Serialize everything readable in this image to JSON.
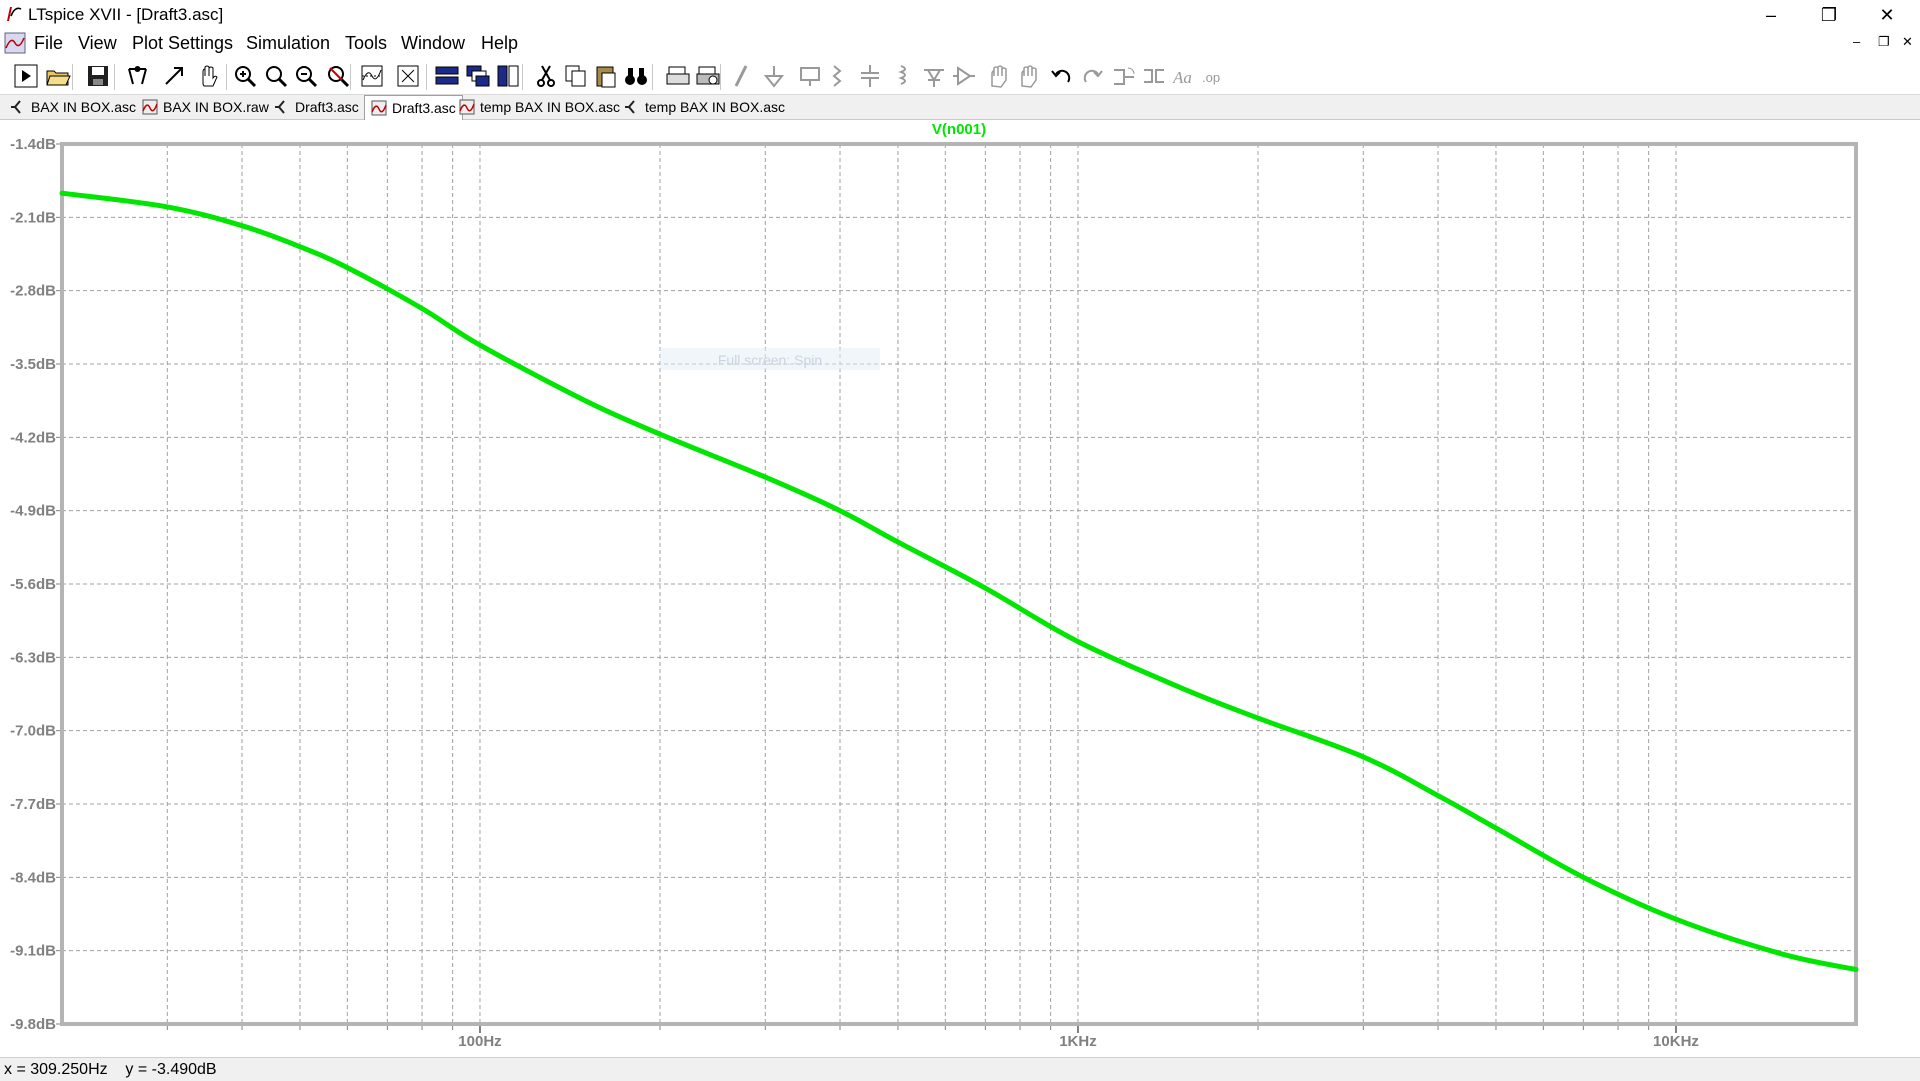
{
  "window": {
    "title": "LTspice XVII - [Draft3.asc]",
    "controls": {
      "minimize": "–",
      "restore": "❐",
      "close": "✕"
    }
  },
  "menu": {
    "items": [
      "File",
      "View",
      "Plot Settings",
      "Simulation",
      "Tools",
      "Window",
      "Help"
    ],
    "mdi_controls": {
      "minimize": "–",
      "restore": "❐",
      "close": "✕"
    }
  },
  "toolbar": {
    "buttons": [
      "run-icon",
      "open-icon",
      "save-icon",
      "control-panel-icon",
      "halt-icon",
      "pan-icon",
      "zoom-in-icon",
      "zoom-area-icon",
      "zoom-out-icon",
      "zoom-fit-icon",
      "autorange-icon",
      "zoom-extents-icon",
      "tile-horizontal-icon",
      "cascade-icon",
      "tile-vertical-icon",
      "cut-icon",
      "copy-icon",
      "paste-icon",
      "find-icon",
      "print-icon",
      "print-preview-icon",
      "wire-icon",
      "ground-icon",
      "label-icon",
      "resistor-icon",
      "capacitor-icon",
      "inductor-icon",
      "diode-icon",
      "component-icon",
      "move-icon",
      "drag-icon",
      "undo-icon",
      "redo-icon",
      "rotate-icon",
      "mirror-icon",
      "text-icon",
      "spice-directive-icon"
    ]
  },
  "tabs": [
    {
      "label": "BAX IN BOX.asc",
      "icon": "schematic-icon",
      "active": false
    },
    {
      "label": "BAX IN BOX.raw",
      "icon": "waveform-icon",
      "active": false
    },
    {
      "label": "Draft3.asc",
      "icon": "schematic-icon",
      "active": false
    },
    {
      "label": "Draft3.asc",
      "icon": "waveform-icon",
      "active": true
    },
    {
      "label": "temp BAX IN BOX.asc",
      "icon": "waveform-icon",
      "active": false
    },
    {
      "label": "temp BAX IN BOX.asc",
      "icon": "schematic-icon",
      "active": false
    }
  ],
  "chart_data": {
    "type": "line",
    "title": "V(n001)",
    "x_scale": "log",
    "xlim": [
      20,
      20000
    ],
    "ylim": [
      -9.8,
      -1.4
    ],
    "x_ticks": [
      {
        "value": 100,
        "label": "100Hz"
      },
      {
        "value": 1000,
        "label": "1KHz"
      },
      {
        "value": 10000,
        "label": "10KHz"
      }
    ],
    "y_ticks": [
      {
        "value": -1.4,
        "label": "-1.4dB"
      },
      {
        "value": -2.1,
        "label": "-2.1dB"
      },
      {
        "value": -2.8,
        "label": "-2.8dB"
      },
      {
        "value": -3.5,
        "label": "-3.5dB"
      },
      {
        "value": -4.2,
        "label": "-4.2dB"
      },
      {
        "value": -4.9,
        "label": "-4.9dB"
      },
      {
        "value": -5.6,
        "label": "-5.6dB"
      },
      {
        "value": -6.3,
        "label": "-6.3dB"
      },
      {
        "value": -7.0,
        "label": "-7.0dB"
      },
      {
        "value": -7.7,
        "label": "-7.7dB"
      },
      {
        "value": -8.4,
        "label": "-8.4dB"
      },
      {
        "value": -9.1,
        "label": "-9.1dB"
      },
      {
        "value": -9.8,
        "label": "-9.8dB"
      }
    ],
    "grid": true,
    "grid_style": "dashed",
    "series": [
      {
        "name": "V(n001)",
        "color": "#00e600",
        "x": [
          20,
          30,
          40,
          50,
          60,
          80,
          100,
          150,
          200,
          300,
          400,
          500,
          700,
          1000,
          1500,
          2000,
          3000,
          4000,
          5000,
          7000,
          10000,
          15000,
          20000
        ],
        "y": [
          -1.87,
          -2.0,
          -2.18,
          -2.38,
          -2.58,
          -2.97,
          -3.32,
          -3.85,
          -4.17,
          -4.58,
          -4.9,
          -5.2,
          -5.64,
          -6.15,
          -6.6,
          -6.88,
          -7.25,
          -7.62,
          -7.93,
          -8.4,
          -8.8,
          -9.13,
          -9.28
        ]
      }
    ],
    "watermark": "Full screen: Spin",
    "colors": {
      "background": "#ffffff",
      "frame": "#b4b4b4",
      "grid": "#a0a0a0",
      "title": "#00e600"
    }
  },
  "status": {
    "text": "x = 309.250Hz    y = -3.490dB"
  }
}
